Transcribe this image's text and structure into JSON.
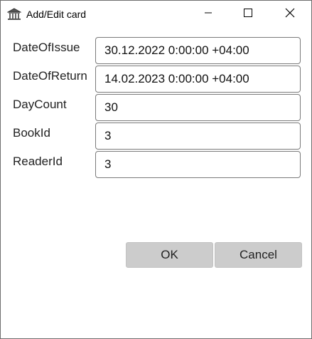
{
  "window": {
    "title": "Add/Edit card",
    "icons": {
      "app": "bank-icon",
      "minimize": "minimize-icon",
      "maximize": "maximize-icon",
      "close": "close-icon"
    }
  },
  "form": {
    "fields": [
      {
        "label": "DateOfIssue",
        "value": "30.12.2022 0:00:00 +04:00"
      },
      {
        "label": "DateOfReturn",
        "value": "14.02.2023 0:00:00 +04:00"
      },
      {
        "label": "DayCount",
        "value": "30"
      },
      {
        "label": "BookId",
        "value": "3"
      },
      {
        "label": "ReaderId",
        "value": "3"
      }
    ]
  },
  "buttons": {
    "ok": "OK",
    "cancel": "Cancel"
  }
}
